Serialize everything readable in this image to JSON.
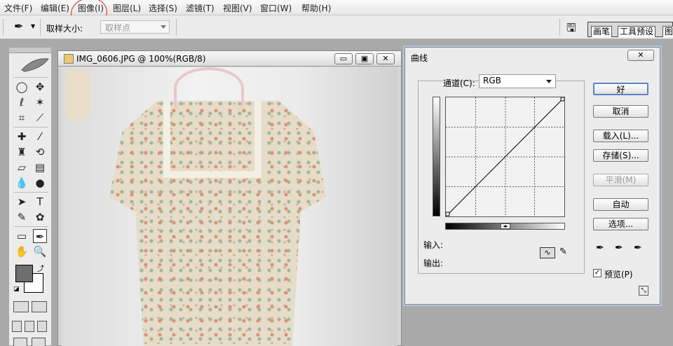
{
  "menu": [
    "文件(F)",
    "编辑(E)",
    "图像(I)",
    "图层(L)",
    "选择(S)",
    "滤镜(T)",
    "视图(V)",
    "窗口(W)",
    "帮助(H)"
  ],
  "options": {
    "sample_size_label": "取样大小:",
    "sample_size_value": "取样点"
  },
  "panel_tabs": [
    "画笔",
    "工具预设",
    "图"
  ],
  "document": {
    "title": "IMG_0606.JPG @ 100%(RGB/8)",
    "buttons": [
      "▭",
      "▣",
      "✕"
    ]
  },
  "curves": {
    "title": "曲线",
    "close": "✕",
    "channel_label": "通道(C):",
    "channel_value": "RGB",
    "input_label": "输入:",
    "output_label": "输出:",
    "buttons": [
      "好",
      "取消",
      "载入(L)...",
      "存储(S)...",
      "平滑(M)",
      "自动",
      "选项..."
    ],
    "preview_label": "预览(P)",
    "preview_checked": true
  },
  "colors": {
    "accent": "#5a83c8",
    "annotation": "#dd2222",
    "foreground": "#6e6e6e",
    "background": "#ffffff"
  }
}
